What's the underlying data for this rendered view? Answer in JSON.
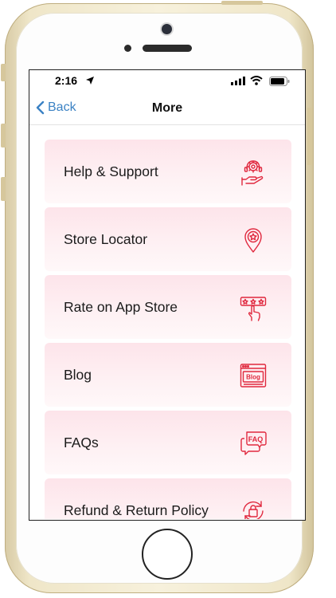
{
  "status_bar": {
    "time": "2:16",
    "icons": [
      "location-arrow-icon",
      "cellular-signal-icon",
      "wifi-icon",
      "battery-icon"
    ]
  },
  "nav": {
    "back_label": "Back",
    "title": "More"
  },
  "menu": {
    "items": [
      {
        "label": "Help & Support",
        "icon": "help-support-icon"
      },
      {
        "label": "Store Locator",
        "icon": "store-locator-icon"
      },
      {
        "label": "Rate on App Store",
        "icon": "rate-app-icon"
      },
      {
        "label": "Blog",
        "icon": "blog-icon",
        "icon_text": "Blog"
      },
      {
        "label": "FAQs",
        "icon": "faq-icon",
        "icon_text": "FAQ"
      },
      {
        "label": "Refund & Return Policy",
        "icon": "refund-policy-icon"
      }
    ]
  },
  "colors": {
    "accent": "#3b82c4",
    "icon_red": "#e0283e",
    "card_bg": "#fde4ea"
  }
}
